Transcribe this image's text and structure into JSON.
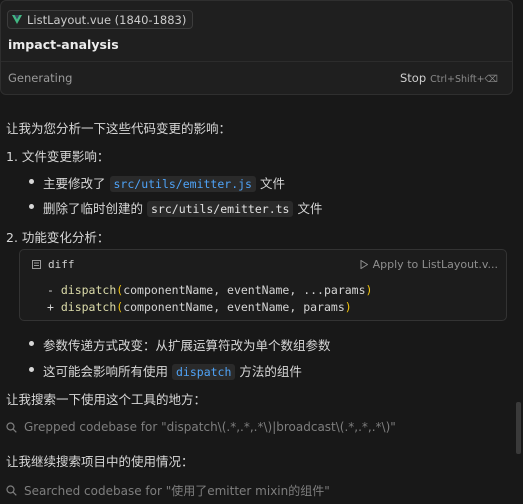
{
  "header": {
    "file_chip": "ListLayout.vue (1840-1883)",
    "title": "impact-analysis",
    "status": "Generating",
    "stop_label": "Stop",
    "stop_shortcut": "Ctrl+Shift+⌫"
  },
  "message": {
    "intro": "让我为您分析一下这些代码变更的影响：",
    "section1": {
      "heading": "1. 文件变更影响：",
      "bullet1": {
        "prefix": "主要修改了",
        "code": "src/utils/emitter.js",
        "suffix": "文件"
      },
      "bullet2": {
        "prefix": "删除了临时创建的",
        "code": "src/utils/emitter.ts",
        "suffix": "文件"
      }
    },
    "section2": {
      "heading": "2. 功能变化分析："
    },
    "code_block": {
      "language": "diff",
      "apply_label": "Apply to ListLayout.v...",
      "line1": {
        "sign": "- ",
        "fn": "dispatch",
        "args": "componentName, eventName, ...params"
      },
      "line2": {
        "sign": "+ ",
        "fn": "dispatch",
        "args": "componentName, eventName, params"
      }
    },
    "bullet3": "参数传递方式改变：从扩展运算符改为单个数组参数",
    "bullet4": {
      "prefix": "这可能会影响所有使用",
      "code": "dispatch",
      "suffix": "方法的组件"
    },
    "search_intro": "让我搜索一下使用这个工具的地方：",
    "tool1": "Grepped codebase for \"dispatch\\(.*,.*,.*\\)|broadcast\\(.*,.*,.*\\)\"",
    "continue_text": "让我继续搜索项目中的使用情况：",
    "tool2": "Searched codebase for \"使用了emitter mixin的组件\""
  },
  "colors": {
    "accent_green": "#42b883",
    "code_blue": "#4fa3f7",
    "paren_yellow": "#f1c40f"
  }
}
